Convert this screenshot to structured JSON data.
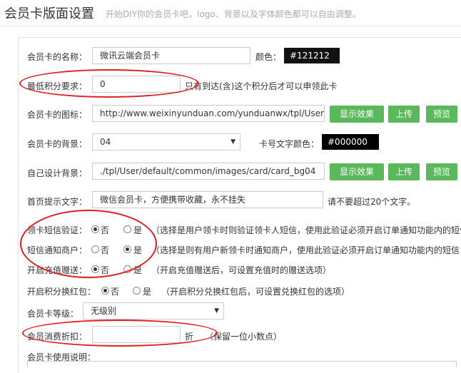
{
  "header": {
    "title": "会员卡版面设置",
    "subtitle": "开始DIY你的会员卡吧，logo、背景以及字体颜色都可以自由调整。"
  },
  "form": {
    "card_name": {
      "label": "会员卡的名称：",
      "value": "微讯云端会员卡",
      "color_label": "颜色：",
      "color_value": "#121212"
    },
    "min_points": {
      "label": "最低积分要求：",
      "value": "0",
      "hint": "只有到达(含)这个积分后才可以申领此卡"
    },
    "card_icon": {
      "label": "会员卡的图标：",
      "value": "http://www.weixinyunduan.com/yunduanwx/tpl/User,",
      "show_label": "显示效果",
      "upload_label": "上传",
      "preview_label": "预览"
    },
    "card_bg": {
      "label": "会员卡的背景：",
      "value": "04",
      "num_color_label": "卡号文字颜色：",
      "num_color_value": "#000000"
    },
    "custom_bg": {
      "label": "自己设计背景：",
      "value": "./tpl/User/default/common/images/card/card_bg04",
      "show_label": "显示效果",
      "upload_label": "上传",
      "preview_label": "预览"
    },
    "home_tip": {
      "label": "首页提示文字：",
      "value": "微信会员卡，方便携带收藏，永不挂失",
      "hint": "请不要超过20个文字。"
    },
    "sms_verify": {
      "label": "领卡短信验证：",
      "no": "否",
      "yes": "是",
      "hint": "（选择是用户领卡时则验证领卡人短信，使用此验证必须开启订单通知功能内的短信"
    },
    "sms_notify": {
      "label": "短信通知商户：",
      "no": "否",
      "yes": "是",
      "hint": "（选择是则有用户新领卡时通知商户，使用此验证必须开启订单通知功能内的短信"
    },
    "recharge_gift": {
      "label": "开启充值赠送：",
      "no": "否",
      "yes": "是",
      "hint": "（开启充值赠送后，可设置充值时的赠送选项）"
    },
    "points_redpack": {
      "label": "开启积分换红包：",
      "no": "否",
      "yes": "是",
      "hint": "（开启积分兑换红包后，可设置兑换红包的选项）"
    },
    "card_level": {
      "label": "会员卡等级：",
      "value": "无级别"
    },
    "discount": {
      "label": "会员消费折扣：",
      "value": "",
      "unit": "折",
      "hint": "（保留一位小数点）"
    },
    "usage": {
      "label": "会员卡使用说明："
    }
  },
  "colors": {
    "accent_green": "#5cb85c",
    "annotation_red": "#e02020"
  }
}
